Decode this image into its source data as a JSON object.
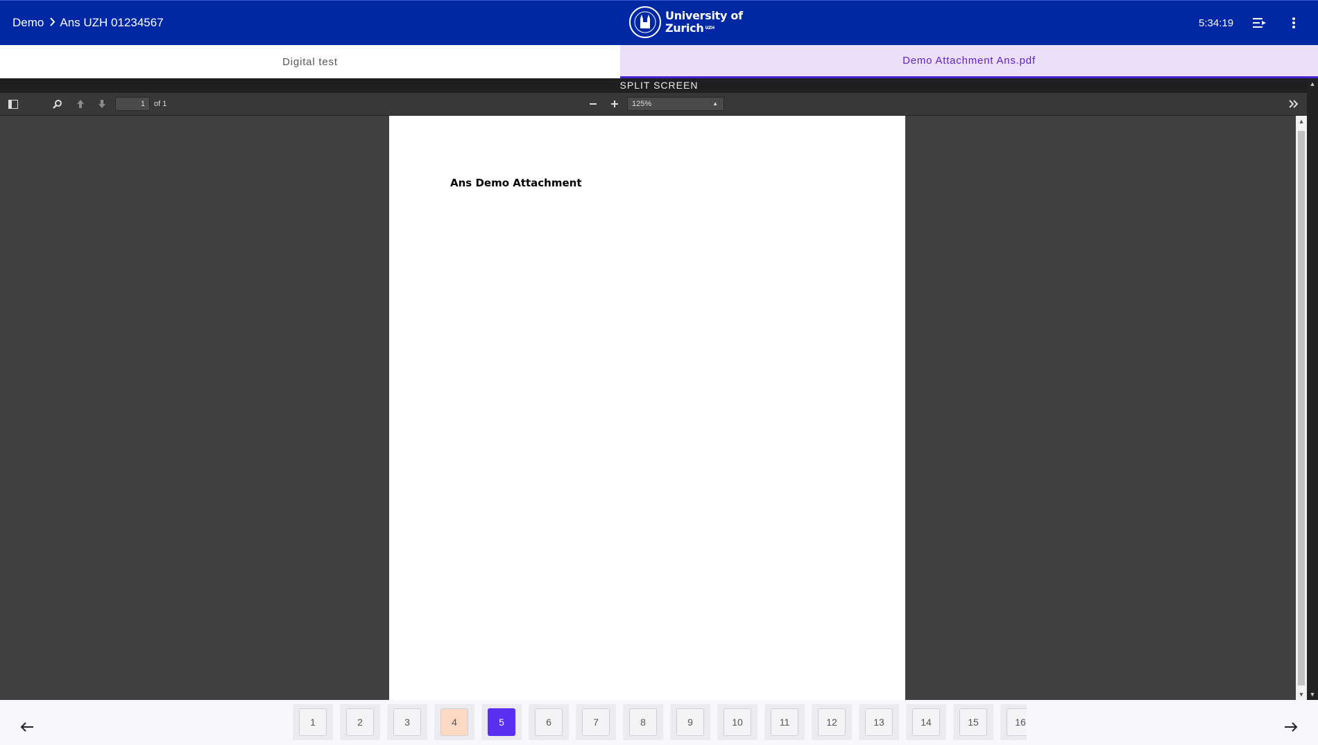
{
  "header": {
    "breadcrumb": [
      "Demo",
      "Ans UZH 01234567"
    ],
    "logo_line1": "University of",
    "logo_line2": "Zurich",
    "logo_sup": "UZH",
    "timer": "5:34:19",
    "icons": [
      "list-icon",
      "more-vert-icon"
    ],
    "background": "#0028a5"
  },
  "tabs": [
    {
      "label": "Digital test",
      "active": false
    },
    {
      "label": "Demo Attachment Ans.pdf",
      "active": true
    }
  ],
  "split_label": "SPLIT SCREEN",
  "pdf_toolbar": {
    "page_current": "1",
    "page_total": "of 1",
    "zoom": "125%",
    "icons": [
      "sidebar-toggle-icon",
      "search-icon",
      "previous-page-icon",
      "next-page-icon",
      "zoom-out-icon",
      "zoom-in-icon",
      "tools-icon"
    ]
  },
  "pdf_page": {
    "heading": "Ans Demo Attachment"
  },
  "question_nav": {
    "items": [
      "1",
      "2",
      "3",
      "4",
      "5",
      "6",
      "7",
      "8",
      "9",
      "10",
      "11",
      "12",
      "13",
      "14",
      "15",
      "16"
    ],
    "flagged": "4",
    "current": "5",
    "current_color": "#5a2ff2",
    "flagged_color": "#fdd9c4"
  }
}
